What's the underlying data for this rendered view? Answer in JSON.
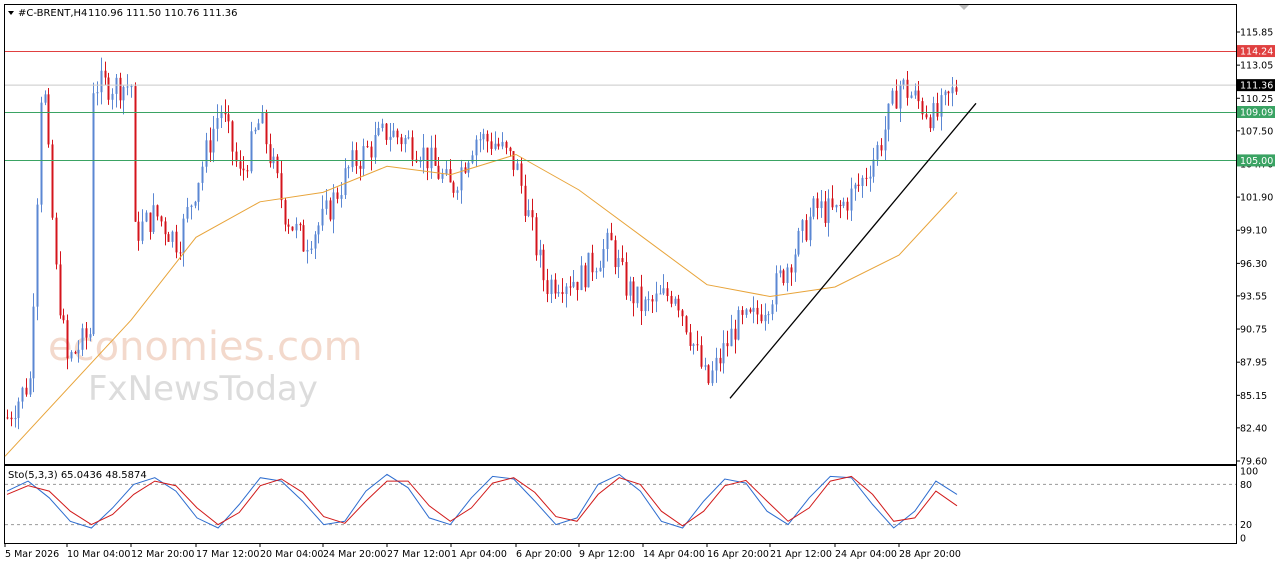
{
  "header": {
    "symbol": "#C-BRENT,H4",
    "ohlc": "110.96 111.50 110.76 111.36"
  },
  "watermark": {
    "line1": "economies.com",
    "line2": "FxNewsToday"
  },
  "colors": {
    "bull": "#5b87d3",
    "bear": "#d4141c",
    "ma": "#e8a43a",
    "resistance": "#e04040",
    "support": "#3aa363",
    "current_price": "#c9c9c9",
    "trendline": "#000000",
    "stoch_main": "#2e6dcf",
    "stoch_signal": "#d11a1a"
  },
  "chart_data": [
    {
      "type": "candlestick",
      "symbol": "#C-BRENT",
      "timeframe": "H4",
      "yticks": [
        115.85,
        113.05,
        110.25,
        107.5,
        104.7,
        101.9,
        99.1,
        96.3,
        93.55,
        90.75,
        87.95,
        85.15,
        82.4,
        79.6
      ],
      "ylim": [
        79.6,
        117.3
      ],
      "xticks": [
        "5 Mar 2026",
        "10 Mar 04:00",
        "12 Mar 20:00",
        "17 Mar 12:00",
        "20 Mar 04:00",
        "24 Mar 20:00",
        "27 Mar 12:00",
        "1 Apr 04:00",
        "6 Apr 20:00",
        "9 Apr 12:00",
        "14 Apr 04:00",
        "16 Apr 20:00",
        "21 Apr 12:00",
        "24 Apr 04:00",
        "28 Apr 20:00"
      ],
      "last_price": 111.36,
      "horizontal_levels": [
        {
          "value": 114.24,
          "label": "114.24",
          "kind": "resistance"
        },
        {
          "value": 109.09,
          "label": "109.09",
          "kind": "support"
        },
        {
          "value": 105.0,
          "label": "105.00",
          "kind": "support"
        }
      ],
      "trendline": {
        "from": {
          "x": "16 Apr 20:00",
          "y": 84.9
        },
        "to": {
          "x": "30 Apr",
          "y": 110.5
        }
      },
      "close_path": [
        [
          "5 Mar 2026",
          83.0
        ],
        [
          "7 Mar",
          86.5
        ],
        [
          "8 Mar",
          113.5
        ],
        [
          "9 Mar",
          96.0
        ],
        [
          "10 Mar 04:00",
          88.0
        ],
        [
          "11 Mar",
          90.5
        ],
        [
          "12 Mar",
          96.5
        ],
        [
          "12 Mar 20:00",
          98.5
        ],
        [
          "14 Mar",
          100.5
        ],
        [
          "16 Mar",
          98.0
        ],
        [
          "17 Mar 12:00",
          103.0
        ],
        [
          "18 Mar",
          109.5
        ],
        [
          "19 Mar",
          103.5
        ],
        [
          "20 Mar 04:00",
          108.5
        ],
        [
          "21 Mar",
          100.5
        ],
        [
          "23 Mar",
          98.0
        ],
        [
          "24 Mar 20:00",
          100.0
        ],
        [
          "26 Mar",
          104.5
        ],
        [
          "27 Mar 12:00",
          107.5
        ],
        [
          "30 Mar",
          106.0
        ],
        [
          "1 Apr 04:00",
          102.5
        ],
        [
          "2 Apr",
          107.0
        ],
        [
          "3 Apr",
          106.5
        ],
        [
          "6 Apr 20:00",
          104.5
        ],
        [
          "7 Apr",
          94.5
        ],
        [
          "8 Apr",
          95.0
        ],
        [
          "9 Apr 12:00",
          95.0
        ],
        [
          "10 Apr",
          98.0
        ],
        [
          "13 Apr",
          94.5
        ],
        [
          "14 Apr 04:00",
          92.5
        ],
        [
          "15 Apr",
          94.0
        ],
        [
          "16 Apr 20:00",
          86.0
        ],
        [
          "17 Apr",
          91.0
        ],
        [
          "20 Apr",
          91.5
        ],
        [
          "21 Apr 12:00",
          93.5
        ],
        [
          "22 Apr",
          97.5
        ],
        [
          "23 Apr",
          101.0
        ],
        [
          "24 Apr 04:00",
          100.5
        ],
        [
          "27 Apr",
          103.0
        ],
        [
          "28 Apr",
          106.5
        ],
        [
          "28 Apr 20:00",
          111.5
        ],
        [
          "29 Apr",
          108.5
        ],
        [
          "30 Apr",
          111.36
        ]
      ],
      "moving_average": [
        [
          "5 Mar 2026",
          80.0
        ],
        [
          "12 Mar 20:00",
          91.5
        ],
        [
          "17 Mar 12:00",
          98.5
        ],
        [
          "20 Mar 04:00",
          101.5
        ],
        [
          "24 Mar 20:00",
          102.3
        ],
        [
          "27 Mar 12:00",
          104.5
        ],
        [
          "1 Apr 04:00",
          103.8
        ],
        [
          "6 Apr 20:00",
          105.5
        ],
        [
          "9 Apr 12:00",
          102.5
        ],
        [
          "14 Apr 04:00",
          98.5
        ],
        [
          "16 Apr 20:00",
          94.5
        ],
        [
          "21 Apr 12:00",
          93.5
        ],
        [
          "24 Apr 04:00",
          94.3
        ],
        [
          "28 Apr 20:00",
          97.0
        ],
        [
          "30 Apr",
          102.3
        ]
      ]
    },
    {
      "type": "line",
      "title": "Sto(5,3,3) 65.0436 48.5874",
      "yticks": [
        100,
        80,
        20,
        0
      ],
      "ylim": [
        0,
        100
      ],
      "levels": [
        80,
        20
      ],
      "series": [
        {
          "values": [
            70,
            85,
            60,
            25,
            15,
            45,
            80,
            90,
            70,
            30,
            15,
            50,
            90,
            85,
            55,
            20,
            25,
            70,
            95,
            75,
            30,
            20,
            60,
            92,
            88,
            55,
            20,
            30,
            80,
            95,
            70,
            25,
            15,
            55,
            88,
            82,
            40,
            20,
            60,
            92,
            90,
            50,
            15,
            40,
            85,
            65
          ]
        },
        {
          "values": [
            65,
            78,
            70,
            40,
            20,
            35,
            65,
            85,
            78,
            45,
            20,
            38,
            78,
            88,
            68,
            32,
            22,
            55,
            85,
            85,
            48,
            25,
            45,
            82,
            90,
            68,
            32,
            25,
            65,
            90,
            80,
            40,
            18,
            40,
            78,
            86,
            55,
            25,
            45,
            85,
            92,
            65,
            25,
            30,
            70,
            48
          ]
        }
      ]
    }
  ]
}
